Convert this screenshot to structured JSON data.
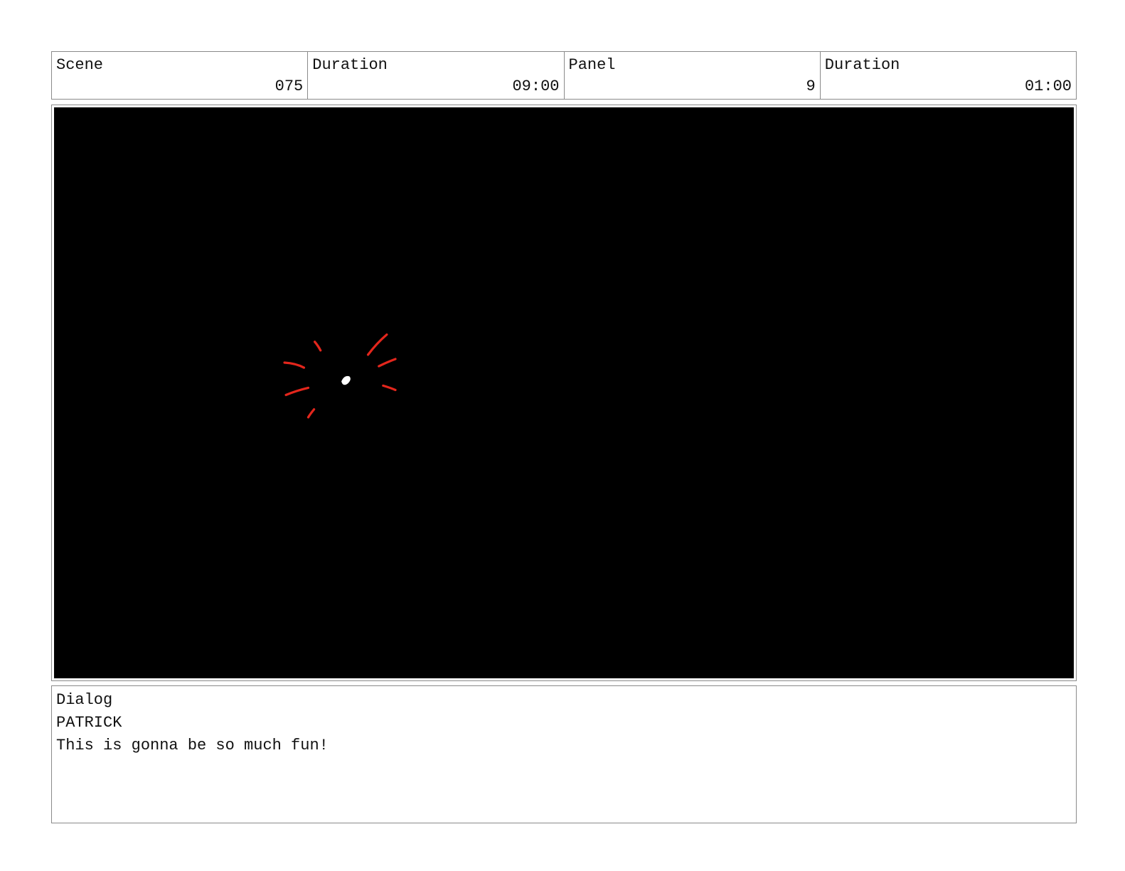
{
  "header": {
    "cells": [
      {
        "label": "Scene",
        "value": "075"
      },
      {
        "label": "Duration",
        "value": "09:00"
      },
      {
        "label": "Panel",
        "value": "9"
      },
      {
        "label": "Duration",
        "value": "01:00"
      }
    ]
  },
  "panel": {
    "background_color": "#000000",
    "stroke_color": "#e3261c",
    "highlight_color": "#ffffff"
  },
  "dialog": {
    "label": "Dialog",
    "character": "PATRICK",
    "line": "This is gonna be so much fun!"
  }
}
